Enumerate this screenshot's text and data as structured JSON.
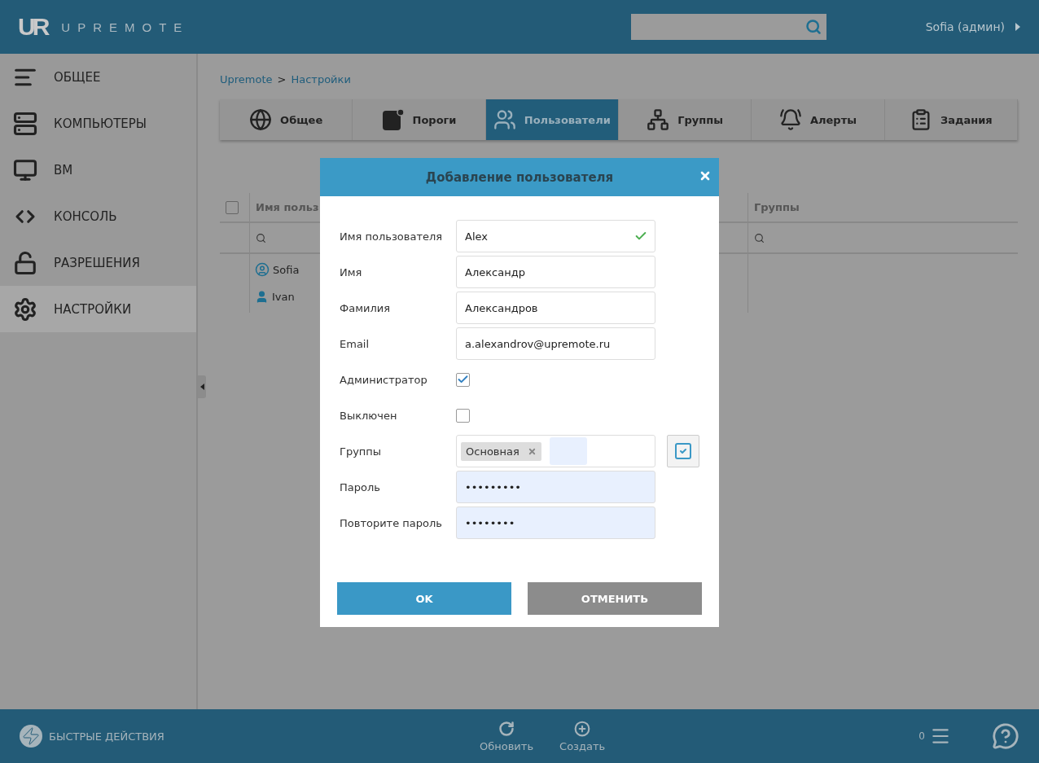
{
  "header": {
    "logo_mark": "UR",
    "logo_text": "UPREMOTE",
    "user": "Sofia (админ)"
  },
  "sidebar": {
    "items": [
      {
        "label": "ОБЩЕЕ",
        "selected": false
      },
      {
        "label": "КОМПЬЮТЕРЫ",
        "selected": false
      },
      {
        "label": "ВМ",
        "selected": false
      },
      {
        "label": "КОНСОЛЬ",
        "selected": false
      },
      {
        "label": "РАЗРЕШЕНИЯ",
        "selected": false
      },
      {
        "label": "НАСТРОЙКИ",
        "selected": true
      }
    ]
  },
  "breadcrumb": {
    "items": [
      "Upremote",
      "Настройки"
    ],
    "separator": ">"
  },
  "tabs": [
    {
      "label": "Общее",
      "selected": false
    },
    {
      "label": "Пороги",
      "selected": false
    },
    {
      "label": "Пользователи",
      "selected": true
    },
    {
      "label": "Группы",
      "selected": false
    },
    {
      "label": "Алерты",
      "selected": false
    },
    {
      "label": "Задания",
      "selected": false
    }
  ],
  "table": {
    "select_all": {
      "checked": false
    },
    "columns": [
      "Имя польз",
      "Группы"
    ],
    "rows": [
      {
        "name": "Sofia"
      },
      {
        "name": "Ivan"
      }
    ]
  },
  "dialog": {
    "title": "Добавление пользователя",
    "fields": [
      {
        "kind": "text",
        "label": "Имя пользователя",
        "value": "Alex",
        "valid": true,
        "autofilled": false
      },
      {
        "kind": "text",
        "label": "Имя",
        "value": "Александр",
        "valid": false,
        "autofilled": false
      },
      {
        "kind": "text",
        "label": "Фамилия",
        "value": "Александров",
        "valid": false,
        "autofilled": false
      },
      {
        "kind": "text",
        "label": "Email",
        "value": "a.alexandrov@upremote.ru",
        "valid": false,
        "autofilled": false
      },
      {
        "kind": "checkbox",
        "label": "Администратор",
        "checked": true
      },
      {
        "kind": "checkbox",
        "label": "Выключен",
        "checked": false
      },
      {
        "kind": "tags",
        "label": "Группы",
        "tags": [
          "Основная"
        ]
      },
      {
        "kind": "text",
        "label": "Пароль",
        "value": "•••••••••",
        "valid": false,
        "autofilled": true
      },
      {
        "kind": "text",
        "label": "Повторите пароль",
        "value": "••••••••",
        "valid": false,
        "autofilled": true
      }
    ],
    "buttons": [
      {
        "label": "OK",
        "kind": "primary"
      },
      {
        "label": "ОТМЕНИТЬ",
        "kind": "secondary"
      }
    ]
  },
  "footer": {
    "quick_actions": "БЫСТРЫЕ ДЕЙСТВИЯ",
    "actions": [
      {
        "label": "Обновить"
      },
      {
        "label": "Создать"
      }
    ],
    "queue_count": "0"
  }
}
